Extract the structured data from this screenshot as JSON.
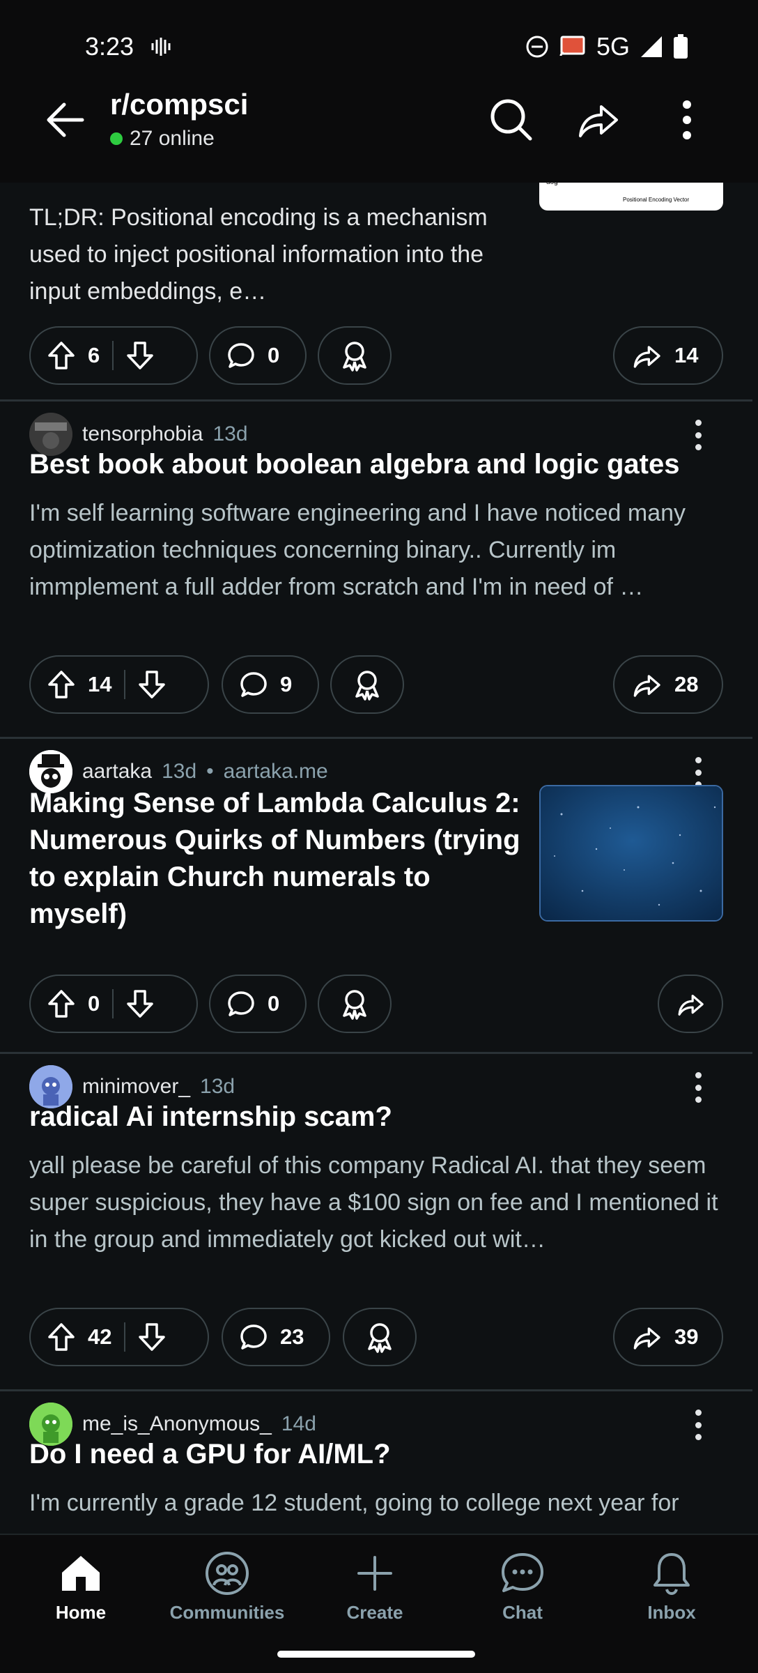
{
  "status": {
    "time": "3:23",
    "network": "5G"
  },
  "header": {
    "subreddit": "r/compsci",
    "online": "27 online"
  },
  "posts": [
    {
      "body": "TL;DR: Positional encoding is a mechanism used to inject positional information into the input embeddings, e…",
      "upvotes": "6",
      "comments": "0",
      "shares": "14",
      "thumb_text": "Positional Encoding Vector",
      "thumb_word": "dog"
    },
    {
      "author": "tensorphobia",
      "age": "13d",
      "title": "Best book about boolean algebra and logic gates",
      "body": "I'm self learning software engineering and I have noticed many optimization techniques concerning binary.. Currently im immplement a full adder from scratch and I'm in need of …",
      "upvotes": "14",
      "comments": "9",
      "shares": "28"
    },
    {
      "author": "aartaka",
      "age": "13d",
      "domain": "aartaka.me",
      "title": "Making Sense of Lambda Calculus 2: Numerous Quirks of Numbers (trying to explain Church numerals to myself)",
      "upvotes": "0",
      "comments": "0"
    },
    {
      "author": "minimover_",
      "age": "13d",
      "title": "radical Ai internship scam?",
      "body": "yall please be careful of this company Radical AI. that they seem super suspicious, they have a $100 sign on fee and I mentioned it in the group and immediately got kicked out wit…",
      "upvotes": "42",
      "comments": "23",
      "shares": "39"
    },
    {
      "author": "me_is_Anonymous_",
      "age": "14d",
      "title": "Do I need a GPU for AI/ML?",
      "body": "I'm currently a grade 12 student, going to college next year for"
    }
  ],
  "nav": {
    "home": "Home",
    "communities": "Communities",
    "create": "Create",
    "chat": "Chat",
    "inbox": "Inbox"
  },
  "colors": {
    "background": "#0e1113",
    "online_dot": "#2ecc40",
    "muted": "#8ba2ad"
  }
}
